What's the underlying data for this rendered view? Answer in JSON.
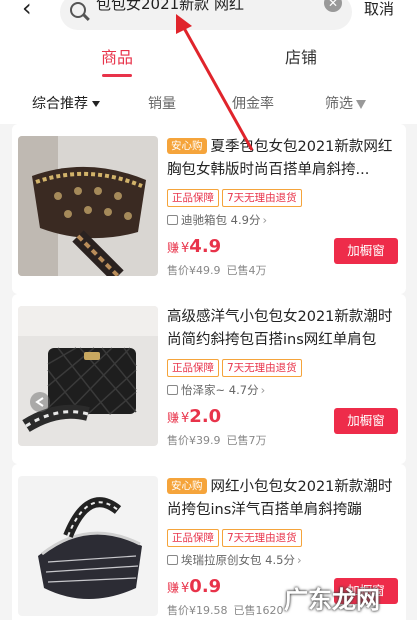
{
  "header": {
    "search_query": "包包女2021新款 网红",
    "cancel_label": "取消"
  },
  "tabs": [
    {
      "label": "商品",
      "active": true
    },
    {
      "label": "店铺",
      "active": false
    }
  ],
  "sort": {
    "overall": "综合推荐",
    "sales": "销量",
    "commission": "佣金率",
    "filter": "筛选"
  },
  "products": [
    {
      "safe_badge": "安心购",
      "title": "夏季包包女包2021新款网红胸包女韩版时尚百搭单肩斜挎...",
      "tags": [
        "正品保障",
        "7天无理由退货"
      ],
      "shop": "迪驰箱包 4.9分",
      "earn_label": "赚",
      "earn_currency": "¥",
      "earn_value": "4.9",
      "price": "售价¥49.9",
      "sold": "已售4万",
      "button_label": "加橱窗"
    },
    {
      "safe_badge": "",
      "title": "高级感洋气小包包女2021新款潮时尚简约斜挎包百搭ins网红单肩包",
      "tags": [
        "正品保障",
        "7天无理由退货"
      ],
      "shop": "怡泽家~ 4.7分",
      "earn_label": "赚",
      "earn_currency": "¥",
      "earn_value": "2.0",
      "price": "售价¥39.9",
      "sold": "已售7万",
      "button_label": "加橱窗"
    },
    {
      "safe_badge": "安心购",
      "title": "网红小包包女2021新款潮时尚挎包ins洋气百搭单肩斜挎蹦",
      "tags": [
        "正品保障",
        "7天无理由退货"
      ],
      "shop": "埃瑞拉原创女包 4.5分",
      "earn_label": "赚",
      "earn_currency": "¥",
      "earn_value": "0.9",
      "price": "售价¥19.58",
      "sold": "已售1620",
      "button_label": "加橱窗"
    }
  ],
  "watermark": "广东龙网",
  "colors": {
    "accent": "#e8334a",
    "badge": "#f5a43b",
    "button": "#ee2c4a"
  }
}
